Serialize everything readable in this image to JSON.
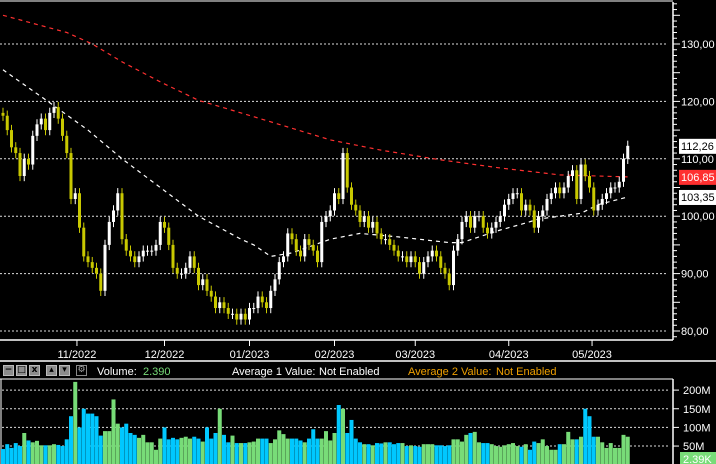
{
  "chart_data": {
    "type": "candlestick",
    "price_axis": {
      "ticks": [
        80,
        90,
        100,
        110,
        120,
        130
      ],
      "tick_labels": [
        "80,00",
        "90,00",
        "100,00",
        "110,00",
        "120,00",
        "130,00"
      ],
      "ylim": [
        78.5,
        137.5
      ],
      "grid": true
    },
    "x_axis": {
      "labels": [
        "11/2022",
        "12/2022",
        "01/2023",
        "02/2023",
        "03/2023",
        "04/2023",
        "05/2023"
      ],
      "label_candle_index": [
        17.4,
        38,
        58,
        78,
        97,
        119,
        138.6
      ]
    },
    "close": [
      117.5,
      115,
      112,
      111,
      107,
      110,
      109,
      114,
      116,
      117,
      115,
      118,
      119,
      117,
      114,
      111,
      103,
      104,
      98,
      93,
      92,
      91,
      90,
      87,
      95,
      99,
      101,
      104,
      96,
      94,
      93,
      92,
      93,
      94,
      94,
      94,
      95,
      99,
      98,
      95,
      91,
      90,
      90,
      91,
      93,
      91,
      88,
      89,
      87,
      86,
      84,
      85,
      84,
      83,
      83,
      82,
      83,
      82,
      84,
      84,
      86,
      85,
      84,
      87,
      89,
      92,
      93,
      97,
      96,
      94,
      93,
      96,
      95,
      94,
      92,
      99,
      100,
      101,
      104,
      103,
      111,
      105,
      102,
      101,
      99,
      100,
      98,
      99,
      97,
      96,
      96,
      95,
      94,
      93,
      93,
      92,
      93,
      92,
      90,
      92,
      93,
      94,
      93,
      91,
      90,
      88,
      94,
      96,
      99,
      100,
      98,
      100,
      100,
      98,
      97,
      98,
      99,
      100,
      102,
      103,
      104,
      104,
      101,
      102,
      101,
      98,
      100,
      101,
      103,
      104,
      105,
      104,
      105,
      107,
      108,
      103,
      109,
      107,
      105,
      101,
      102,
      103,
      104,
      105,
      105,
      106,
      110,
      112.26
    ],
    "first_open": 118,
    "ma_short": [
      [
        0,
        125.5
      ],
      [
        10,
        120.3
      ],
      [
        20,
        115
      ],
      [
        28,
        110
      ],
      [
        46,
        100
      ],
      [
        56,
        96
      ],
      [
        59,
        95
      ],
      [
        63,
        93
      ],
      [
        68,
        93.6
      ],
      [
        77,
        96
      ],
      [
        84,
        97
      ],
      [
        93,
        96.4
      ],
      [
        105,
        95.4
      ],
      [
        108,
        95.4
      ],
      [
        112,
        96.4
      ],
      [
        117,
        97.6
      ],
      [
        122,
        98.6
      ],
      [
        126,
        99.5
      ],
      [
        131,
        100
      ],
      [
        136,
        100.5
      ],
      [
        140,
        102
      ],
      [
        147,
        103.35
      ]
    ],
    "ma_long": [
      [
        0,
        135
      ],
      [
        15,
        132
      ],
      [
        21,
        130
      ],
      [
        28,
        126.9
      ],
      [
        37,
        123.4
      ],
      [
        46,
        120.2
      ],
      [
        56,
        118
      ],
      [
        65,
        116
      ],
      [
        77,
        113.3
      ],
      [
        89,
        111.5
      ],
      [
        103,
        109.8
      ],
      [
        117,
        108.4
      ],
      [
        131,
        107.2
      ],
      [
        147,
        106.85
      ]
    ],
    "price_labels": [
      {
        "text": "112,26",
        "value": 112.26,
        "color": "#ffffff"
      },
      {
        "text": "106,85",
        "value": 106.85,
        "color": "#ff3030"
      },
      {
        "text": "103,35",
        "value": 103.35,
        "color": "#ffffff"
      }
    ],
    "volume": {
      "values_m": [
        42,
        55,
        45,
        58,
        50,
        85,
        65,
        60,
        64,
        52,
        52,
        52,
        55,
        53,
        50,
        68,
        130,
        222,
        100,
        150,
        137,
        137,
        130,
        78,
        90,
        90,
        175,
        110,
        100,
        110,
        85,
        80,
        72,
        80,
        60,
        60,
        40,
        70,
        100,
        68,
        72,
        68,
        72,
        75,
        70,
        75,
        70,
        62,
        100,
        70,
        85,
        150,
        80,
        60,
        78,
        58,
        58,
        58,
        60,
        62,
        70,
        70,
        70,
        58,
        68,
        92,
        82,
        70,
        70,
        70,
        65,
        60,
        70,
        95,
        70,
        70,
        90,
        65,
        85,
        160,
        150,
        85,
        120,
        70,
        60,
        55,
        55,
        52,
        58,
        57,
        60,
        60,
        55,
        58,
        58,
        50,
        52,
        50,
        48,
        55,
        55,
        55,
        52,
        52,
        50,
        52,
        68,
        68,
        62,
        80,
        85,
        88,
        60,
        58,
        58,
        55,
        50,
        48,
        52,
        55,
        58,
        50,
        48,
        55,
        40,
        62,
        58,
        68,
        50,
        40,
        40,
        55,
        55,
        88,
        68,
        68,
        75,
        150,
        130,
        75,
        75,
        60,
        45,
        58,
        45,
        45,
        80,
        75
      ],
      "ticks": [
        50,
        100,
        150,
        200
      ],
      "tick_labels": [
        "50M",
        "100M",
        "150M",
        "200M"
      ],
      "last_label": "2.39K",
      "up_color": "#78dc78",
      "down_color": "#00c8ff"
    },
    "colors": {
      "up_candle": "#ffffff",
      "down_candle": "#c8c800",
      "ma_short": "#ffffff",
      "ma_long": "#ff3030"
    }
  },
  "volume_header": {
    "volume_label": "Volume:",
    "volume_value": "2.390",
    "avg1_label": "Average 1 Value:",
    "avg1_value": "Not Enabled",
    "avg2_label": "Average 2 Value:",
    "avg2_value": "Not Enabled",
    "buttons": [
      "minimize",
      "maximize",
      "close",
      "move-up",
      "move-down",
      "settings"
    ]
  }
}
